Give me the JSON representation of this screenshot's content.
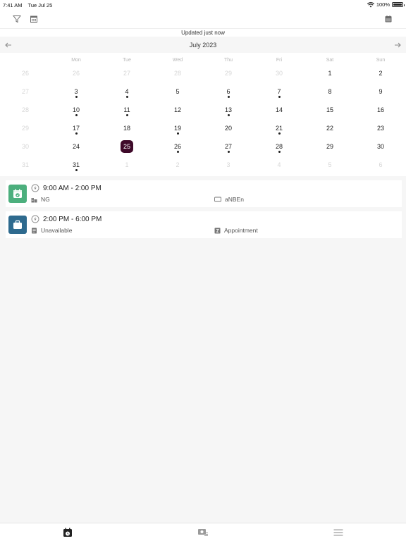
{
  "status_bar": {
    "time": "7:41 AM",
    "date": "Tue Jul 25",
    "battery": "100%"
  },
  "updated_text": "Updated just now",
  "calendar": {
    "month_title": "July 2023",
    "weekdays": [
      "Mon",
      "Tue",
      "Wed",
      "Thu",
      "Fri",
      "Sat",
      "Sun"
    ],
    "weeks": [
      {
        "week": "26",
        "days": [
          {
            "d": "26",
            "muted": true,
            "dot": false
          },
          {
            "d": "27",
            "muted": true,
            "dot": false
          },
          {
            "d": "28",
            "muted": true,
            "dot": false
          },
          {
            "d": "29",
            "muted": true,
            "dot": false
          },
          {
            "d": "30",
            "muted": true,
            "dot": false
          },
          {
            "d": "1",
            "muted": false,
            "dot": false
          },
          {
            "d": "2",
            "muted": false,
            "dot": false
          }
        ]
      },
      {
        "week": "27",
        "days": [
          {
            "d": "3",
            "muted": false,
            "dot": true
          },
          {
            "d": "4",
            "muted": false,
            "dot": true
          },
          {
            "d": "5",
            "muted": false,
            "dot": false
          },
          {
            "d": "6",
            "muted": false,
            "dot": true
          },
          {
            "d": "7",
            "muted": false,
            "dot": true
          },
          {
            "d": "8",
            "muted": false,
            "dot": false
          },
          {
            "d": "9",
            "muted": false,
            "dot": false
          }
        ]
      },
      {
        "week": "28",
        "days": [
          {
            "d": "10",
            "muted": false,
            "dot": true
          },
          {
            "d": "11",
            "muted": false,
            "dot": true
          },
          {
            "d": "12",
            "muted": false,
            "dot": false
          },
          {
            "d": "13",
            "muted": false,
            "dot": true
          },
          {
            "d": "14",
            "muted": false,
            "dot": false
          },
          {
            "d": "15",
            "muted": false,
            "dot": false
          },
          {
            "d": "16",
            "muted": false,
            "dot": false
          }
        ]
      },
      {
        "week": "29",
        "days": [
          {
            "d": "17",
            "muted": false,
            "dot": true
          },
          {
            "d": "18",
            "muted": false,
            "dot": false
          },
          {
            "d": "19",
            "muted": false,
            "dot": true
          },
          {
            "d": "20",
            "muted": false,
            "dot": false
          },
          {
            "d": "21",
            "muted": false,
            "dot": true
          },
          {
            "d": "22",
            "muted": false,
            "dot": false
          },
          {
            "d": "23",
            "muted": false,
            "dot": false
          }
        ]
      },
      {
        "week": "30",
        "days": [
          {
            "d": "24",
            "muted": false,
            "dot": false
          },
          {
            "d": "25",
            "muted": false,
            "dot": false,
            "today": true
          },
          {
            "d": "26",
            "muted": false,
            "dot": true
          },
          {
            "d": "27",
            "muted": false,
            "dot": true
          },
          {
            "d": "28",
            "muted": false,
            "dot": true
          },
          {
            "d": "29",
            "muted": false,
            "dot": false
          },
          {
            "d": "30",
            "muted": false,
            "dot": false
          }
        ]
      },
      {
        "week": "31",
        "days": [
          {
            "d": "31",
            "muted": false,
            "dot": true
          },
          {
            "d": "1",
            "muted": true,
            "dot": false
          },
          {
            "d": "2",
            "muted": true,
            "dot": false
          },
          {
            "d": "3",
            "muted": true,
            "dot": false
          },
          {
            "d": "4",
            "muted": true,
            "dot": false
          },
          {
            "d": "5",
            "muted": true,
            "dot": false
          },
          {
            "d": "6",
            "muted": true,
            "dot": false
          }
        ]
      }
    ]
  },
  "events": [
    {
      "time": "9:00 AM - 2:00 PM",
      "left_value": "NG",
      "right_value": "aNBEn",
      "icon": "calendar-check-icon",
      "color": "#4caf7d"
    },
    {
      "time": "2:00 PM - 6:00 PM",
      "left_value": "Unavailable",
      "right_value": "Appointment",
      "icon": "briefcase-icon",
      "color": "#2e6a8e"
    }
  ],
  "colors": {
    "today": "#3f0a2a",
    "accent_gray": "#6b6b6b"
  }
}
